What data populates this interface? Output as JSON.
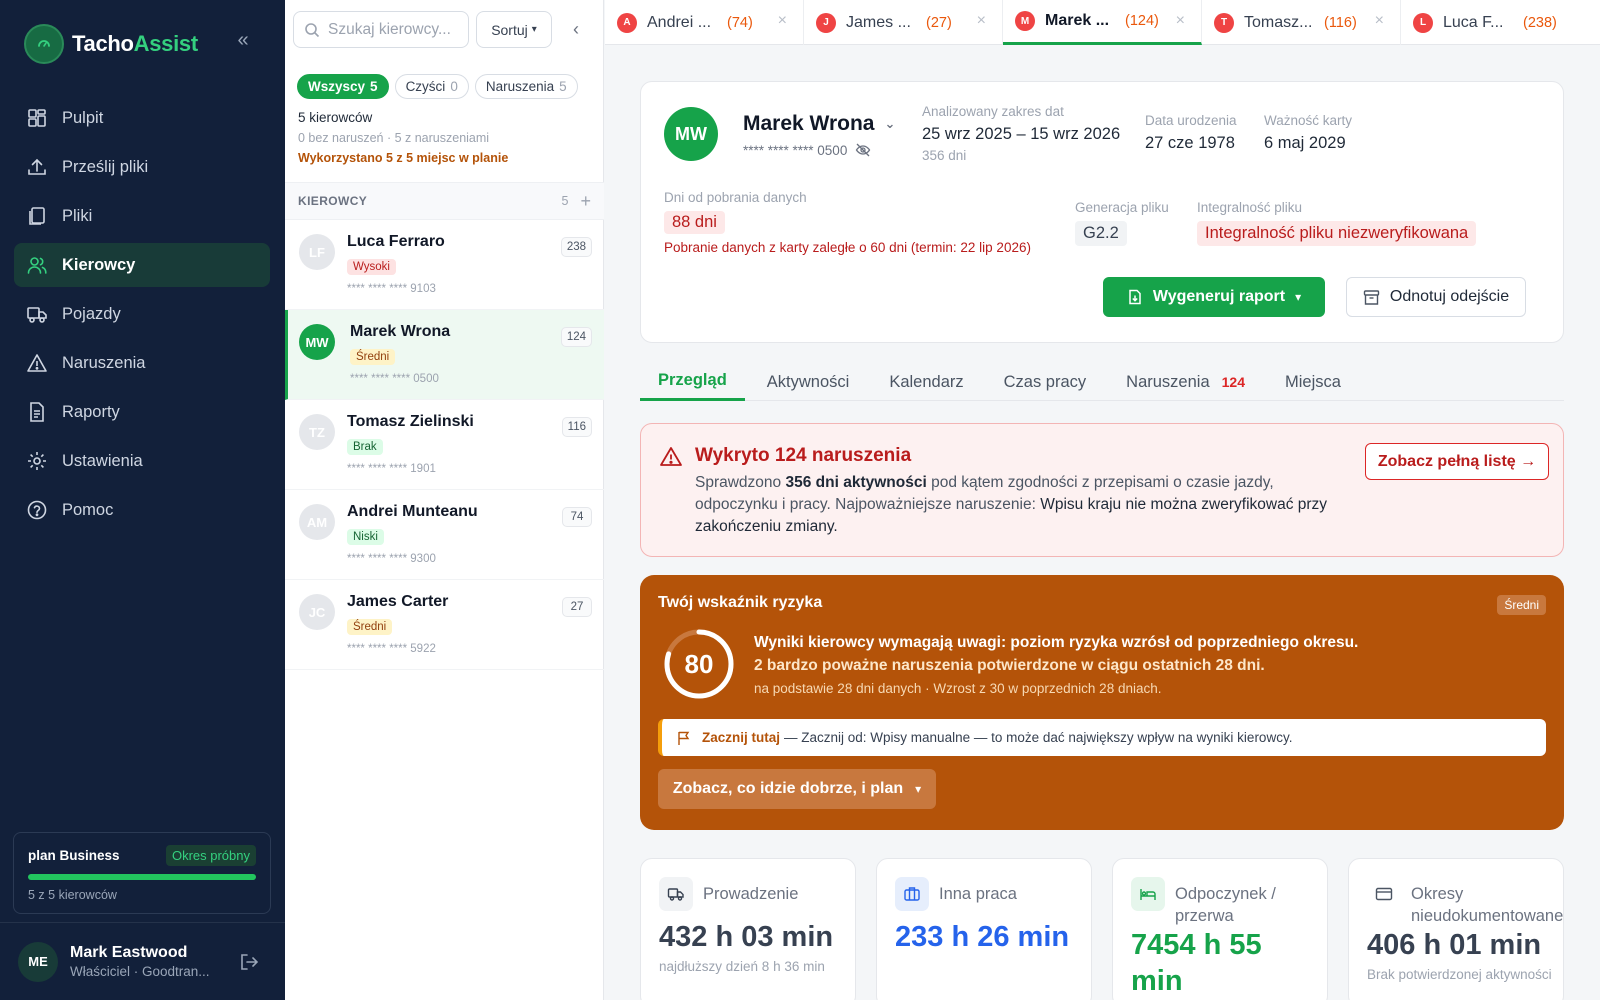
{
  "brand": {
    "name_part1": "Tacho",
    "name_part2": "Assist"
  },
  "sidebar": {
    "items": [
      {
        "label": "Pulpit",
        "icon": "dashboard-icon"
      },
      {
        "label": "Prześlij pliki",
        "icon": "upload-icon"
      },
      {
        "label": "Pliki",
        "icon": "files-icon"
      },
      {
        "label": "Kierowcy",
        "icon": "users-icon",
        "active": true
      },
      {
        "label": "Pojazdy",
        "icon": "truck-icon"
      },
      {
        "label": "Naruszenia",
        "icon": "warning-icon"
      },
      {
        "label": "Raporty",
        "icon": "report-icon"
      },
      {
        "label": "Ustawienia",
        "icon": "gear-icon"
      },
      {
        "label": "Pomoc",
        "icon": "help-icon"
      }
    ],
    "plan": {
      "name": "plan Business",
      "trial": "Okres próbny",
      "usage": "5 z 5 kierowców",
      "usage_fraction": 1.0
    },
    "user": {
      "initials": "ME",
      "name": "Mark Eastwood",
      "role": "Właściciel · Goodtran..."
    }
  },
  "list": {
    "search_placeholder": "Szukaj kierowcy...",
    "sort_label": "Sortuj",
    "filters": [
      {
        "label": "Wszyscy",
        "count": "5",
        "active": true
      },
      {
        "label": "Czyści",
        "count": "0"
      },
      {
        "label": "Naruszenia",
        "count": "5"
      }
    ],
    "summary": {
      "count": "5 kierowców",
      "detail": "0 bez naruszeń · 5 z naruszeniami",
      "plan_usage": "Wykorzystano 5 z 5 miejsc w planie"
    },
    "header_label": "KIEROWCY",
    "header_count": "5",
    "drivers": [
      {
        "initials": "LF",
        "name": "Luca Ferraro",
        "risk": "Wysoki",
        "risk_level": "high",
        "card": "**** **** **** 9103",
        "count": "238"
      },
      {
        "initials": "MW",
        "name": "Marek Wrona",
        "risk": "Średni",
        "risk_level": "mid",
        "card": "**** **** **** 0500",
        "count": "124",
        "active": true
      },
      {
        "initials": "TZ",
        "name": "Tomasz Zielinski",
        "risk": "Brak",
        "risk_level": "none",
        "card": "**** **** **** 1901",
        "count": "116"
      },
      {
        "initials": "AM",
        "name": "Andrei Munteanu",
        "risk": "Niski",
        "risk_level": "low",
        "card": "**** **** **** 9300",
        "count": "74"
      },
      {
        "initials": "JC",
        "name": "James Carter",
        "risk": "Średni",
        "risk_level": "mid",
        "card": "**** **** **** 5922",
        "count": "27"
      }
    ]
  },
  "tabs": [
    {
      "initial": "A",
      "name": "Andrei ...",
      "count": "(74)"
    },
    {
      "initial": "J",
      "name": "James ...",
      "count": "(27)"
    },
    {
      "initial": "M",
      "name": "Marek ...",
      "count": "(124)",
      "active": true
    },
    {
      "initial": "T",
      "name": "Tomasz...",
      "count": "(116)"
    },
    {
      "initial": "L",
      "name": "Luca F...",
      "count": "(238)"
    }
  ],
  "profile": {
    "initials": "MW",
    "name": "Marek Wrona",
    "card": "**** **** **** 0500",
    "range_label": "Analizowany zakres dat",
    "range_value": "25 wrz 2025 – 15 wrz 2026",
    "range_days": "356 dni",
    "birth_label": "Data urodzenia",
    "birth_value": "27 cze 1978",
    "card_valid_label": "Ważność karty",
    "card_valid_value": "6 maj 2029",
    "download_label": "Dni od pobrania danych",
    "download_value": "88 dni",
    "download_warning": "Pobranie danych z karty zaległe o 60 dni (termin: 22 lip 2026)",
    "gen_label": "Generacja pliku",
    "gen_value": "G2.2",
    "integrity_label": "Integralność pliku",
    "integrity_value": "Integralność pliku niezweryfikowana",
    "report_button": "Wygeneruj raport",
    "note_button": "Odnotuj odejście"
  },
  "subtabs": [
    {
      "label": "Przegląd",
      "active": true
    },
    {
      "label": "Aktywności"
    },
    {
      "label": "Kalendarz"
    },
    {
      "label": "Czas pracy"
    },
    {
      "label": "Naruszenia",
      "count": "124"
    },
    {
      "label": "Miejsca"
    }
  ],
  "alert": {
    "title": "Wykryto 124 naruszenia",
    "body_pre": "Sprawdzono ",
    "body_bold": "356 dni aktywności",
    "body_mid": " pod kątem zgodności z przepisami o czasie jazdy, odpoczynku i pracy. Najpoważniejsze naruszenie: ",
    "body_hl": "Wpisu kraju nie można zweryfikować przy zakończeniu zmiany.",
    "button": "Zobacz pełną listę →"
  },
  "risk": {
    "title": "Twój wskaźnik ryzyka",
    "badge": "Średni",
    "score": "80",
    "score_fraction": 0.8,
    "headline": "Wyniki kierowcy wymagają uwagi: poziom ryzyka wzrósł od poprzedniego okresu.",
    "sub": "2 bardzo poważne naruszenia potwierdzone w ciągu ostatnich 28 dni.",
    "note": "na podstawie 28 dni danych · Wzrost z 30 w poprzednich 28 dniach.",
    "start_label": "Zacznij tutaj",
    "start_text": "— Zacznij od: Wpisy manualne — to może dać największy wpływ na wyniki kierowcy.",
    "button": "Zobacz, co idzie dobrze, i plan"
  },
  "stats": [
    {
      "label": "Prowadzenie",
      "value": "432 h 03 min",
      "note": "najdłuższy dzień 8 h 36 min",
      "color": "#374151",
      "icon": "truck-icon"
    },
    {
      "label": "Inna praca",
      "value": "233 h 26 min",
      "note": "",
      "color": "#2563eb",
      "icon": "briefcase-icon"
    },
    {
      "label": "Odpoczynek / przerwa",
      "value": "7454 h 55 min",
      "note": "",
      "color": "#16a34a",
      "icon": "bed-icon"
    },
    {
      "label": "Okresy nieudokumentowane",
      "value": "406 h 01 min",
      "note": "Brak potwierdzonej aktywności",
      "color": "#374151",
      "icon": "card-icon"
    }
  ]
}
